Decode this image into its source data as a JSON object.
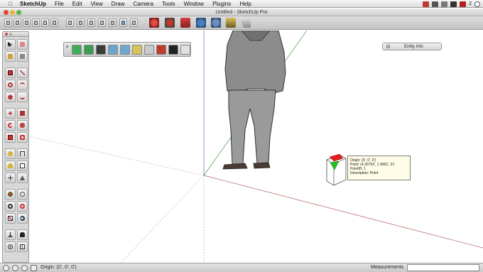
{
  "menubar": {
    "apple": "",
    "items": [
      "SketchUp",
      "File",
      "Edit",
      "View",
      "Draw",
      "Camera",
      "Tools",
      "Window",
      "Plugins",
      "Help"
    ],
    "tray_count": "2"
  },
  "window": {
    "title": "Untitled - SketchUp Pro"
  },
  "entity_info": {
    "title": "Entity Info"
  },
  "tooltip": {
    "origin": "Origin: (0', 0', 0')",
    "point": "Point: (4.20793', 1.3062', 0')",
    "point_id": "PointID: 1",
    "description": "Description: Point"
  },
  "status": {
    "text": "Origin: (0', 0', 0')",
    "measurements_label": "Measurements",
    "measurements_value": ""
  },
  "colors": {
    "axis_red": "#a33a3a",
    "axis_green": "#3a9a3a",
    "axis_blue": "#3a3ab5",
    "inference_red": "#e02020",
    "inference_green": "#20c020",
    "person_fill": "#8a8a8a"
  }
}
